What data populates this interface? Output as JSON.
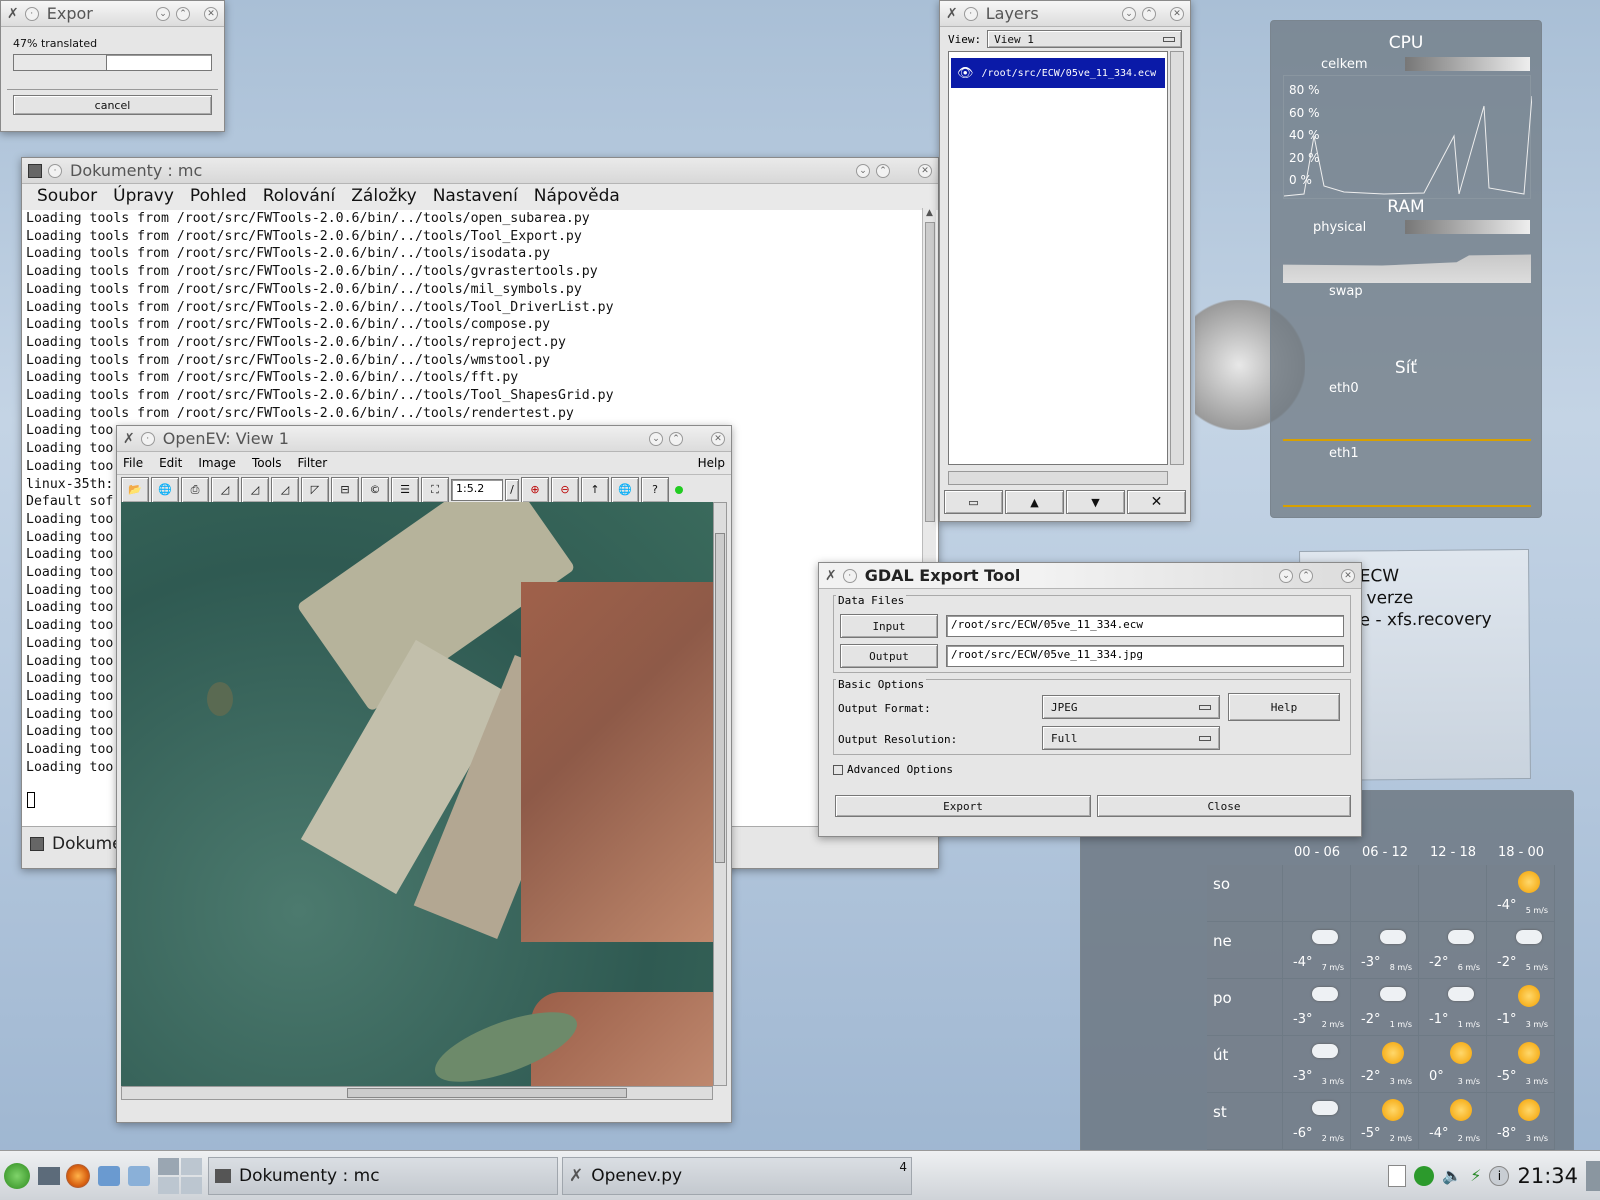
{
  "export_progress": {
    "title": "Expor",
    "progress_text": "47% translated",
    "progress": 0.47,
    "cancel_label": "cancel"
  },
  "mc": {
    "title": "Dokumenty : mc",
    "menu": [
      "Soubor",
      "Úpravy",
      "Pohled",
      "Rolování",
      "Záložky",
      "Nastavení",
      "Nápověda"
    ],
    "lines": [
      "Loading tools from /root/src/FWTools-2.0.6/bin/../tools/open_subarea.py",
      "Loading tools from /root/src/FWTools-2.0.6/bin/../tools/Tool_Export.py",
      "Loading tools from /root/src/FWTools-2.0.6/bin/../tools/isodata.py",
      "Loading tools from /root/src/FWTools-2.0.6/bin/../tools/gvrastertools.py",
      "Loading tools from /root/src/FWTools-2.0.6/bin/../tools/mil_symbols.py",
      "Loading tools from /root/src/FWTools-2.0.6/bin/../tools/Tool_DriverList.py",
      "Loading tools from /root/src/FWTools-2.0.6/bin/../tools/compose.py",
      "Loading tools from /root/src/FWTools-2.0.6/bin/../tools/reproject.py",
      "Loading tools from /root/src/FWTools-2.0.6/bin/../tools/wmstool.py",
      "Loading tools from /root/src/FWTools-2.0.6/bin/../tools/fft.py",
      "Loading tools from /root/src/FWTools-2.0.6/bin/../tools/Tool_ShapesGrid.py",
      "Loading tools from /root/src/FWTools-2.0.6/bin/../tools/rendertest.py",
      "Loading too",
      "Loading too",
      "Loading too",
      "linux-35th:",
      "Default sof",
      "Loading too",
      "Loading too",
      "Loading too",
      "Loading too",
      "Loading too",
      "Loading too",
      "Loading too",
      "Loading too",
      "Loading too",
      "Loading too",
      "Loading too",
      "Loading too",
      "Loading too",
      "Loading too",
      "Loading too"
    ],
    "tab_label": "Dokume"
  },
  "openev": {
    "title": "OpenEV: View 1",
    "menu": [
      "File",
      "Edit",
      "Image",
      "Tools",
      "Filter"
    ],
    "help": "Help",
    "zoom": "1:5.2"
  },
  "layers": {
    "title": "Layers",
    "view_label": "View:",
    "view_value": "View 1",
    "layer_path": "/root/src/ECW/05ve_11_334.ecw"
  },
  "gdal": {
    "title": "GDAL Export Tool",
    "data_files_label": "Data Files",
    "input_btn": "Input",
    "input_value": "/root/src/ECW/05ve_11_334.ecw",
    "output_btn": "Output",
    "output_value": "/root/src/ECW/05ve_11_334.jpg",
    "basic_options_label": "Basic Options",
    "format_label": "Output Format:",
    "format_value": "JPEG",
    "help_btn": "Help",
    "resolution_label": "Output Resolution:",
    "resolution_value": "Full",
    "advanced_label": "Advanced Options",
    "export_btn": "Export",
    "close_btn": "Close"
  },
  "note": {
    "lines": [
      "tor ECW",
      "ální verze",
      "scue - xfs.recovery"
    ]
  },
  "sysmon": {
    "cpu_title": "CPU",
    "cpu_label": "celkem",
    "cpu_ticks": [
      "80 %",
      "60 %",
      "40 %",
      "20 %",
      "0 %"
    ],
    "ram_title": "RAM",
    "ram_physical": "physical",
    "ram_swap": "swap",
    "net_title": "Síť",
    "net_eth0": "eth0",
    "net_eth1": "eth1"
  },
  "weather": {
    "headers": [
      "00 - 06",
      "06 - 12",
      "12 - 18",
      "18 - 00"
    ],
    "days": [
      {
        "day": "so",
        "cells": [
          null,
          null,
          null,
          {
            "icon": "sun",
            "temp": "-4°",
            "wind": "5 m/s"
          }
        ]
      },
      {
        "day": "ne",
        "cells": [
          {
            "icon": "cloud",
            "temp": "-4°",
            "wind": "7 m/s"
          },
          {
            "icon": "cloud",
            "temp": "-3°",
            "wind": "8 m/s"
          },
          {
            "icon": "cloud",
            "temp": "-2°",
            "wind": "6 m/s"
          },
          {
            "icon": "cloud",
            "temp": "-2°",
            "wind": "5 m/s"
          }
        ]
      },
      {
        "day": "po",
        "cells": [
          {
            "icon": "cloud",
            "temp": "-3°",
            "wind": "2 m/s"
          },
          {
            "icon": "cloud",
            "temp": "-2°",
            "wind": "1 m/s"
          },
          {
            "icon": "cloud",
            "temp": "-1°",
            "wind": "1 m/s"
          },
          {
            "icon": "sun",
            "temp": "-1°",
            "wind": "3 m/s"
          }
        ]
      },
      {
        "day": "út",
        "cells": [
          {
            "icon": "cloud",
            "temp": "-3°",
            "wind": "3 m/s"
          },
          {
            "icon": "sun",
            "temp": "-2°",
            "wind": "3 m/s"
          },
          {
            "icon": "sun",
            "temp": "0°",
            "wind": "3 m/s"
          },
          {
            "icon": "sun",
            "temp": "-5°",
            "wind": "3 m/s"
          }
        ]
      },
      {
        "day": "st",
        "cells": [
          {
            "icon": "cloud",
            "temp": "-6°",
            "wind": "2 m/s"
          },
          {
            "icon": "sun",
            "temp": "-5°",
            "wind": "2 m/s"
          },
          {
            "icon": "sun",
            "temp": "-4°",
            "wind": "2 m/s"
          },
          {
            "icon": "sun",
            "temp": "-8°",
            "wind": "3 m/s"
          }
        ]
      }
    ]
  },
  "taskbar": {
    "task1": "Dokumenty : mc",
    "task2": "Openev.py",
    "desktop_num": "4",
    "clock": "21:34"
  }
}
